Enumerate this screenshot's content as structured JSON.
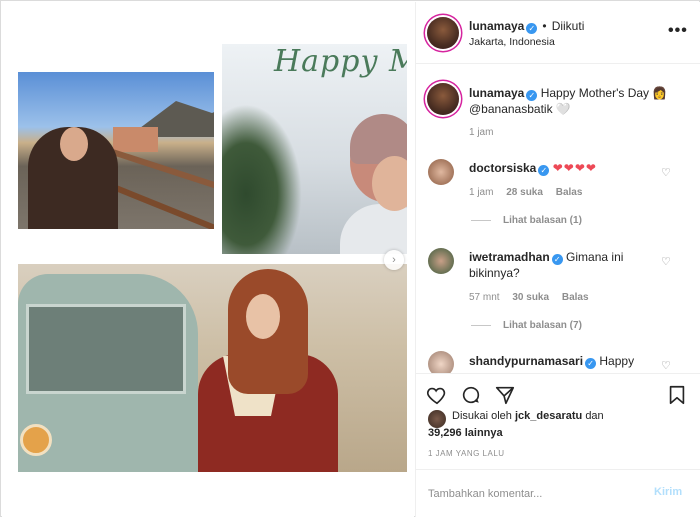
{
  "header": {
    "username": "lunamaya",
    "separator": "•",
    "follow_status": "Diikuti",
    "location": "Jakarta, Indonesia",
    "more_icon": "more-horizontal-icon"
  },
  "caption": {
    "username": "lunamaya",
    "text": "Happy Mother's Day 👩 @bananasbatik 🤍",
    "time": "1 jam"
  },
  "comments": [
    {
      "username": "doctorsiska",
      "text": "❤❤❤❤",
      "time": "1 jam",
      "likes": "28 suka",
      "reply": "Balas",
      "view_replies": "Lihat balasan (1)"
    },
    {
      "username": "iwetramadhan",
      "text": "Gimana ini bikinnya?",
      "time": "57 mnt",
      "likes": "30 suka",
      "reply": "Balas",
      "view_replies": "Lihat balasan (7)"
    },
    {
      "username": "shandypurnamasari",
      "text": "Happy"
    }
  ],
  "photo_overlay_text": "Happy M",
  "likes": {
    "prefix": "Disukai oleh",
    "user": "jck_desaratu",
    "joiner": "dan",
    "count": "39,296",
    "suffix": "lainnya"
  },
  "post_time": "1 JAM YANG LALU",
  "composer": {
    "placeholder": "Tambahkan komentar...",
    "post_label": "Kirim"
  },
  "colors": {
    "verified": "#3897f0",
    "heart": "#ed4956",
    "post_disabled": "#b2dffc",
    "muted": "#8e8e8e"
  }
}
